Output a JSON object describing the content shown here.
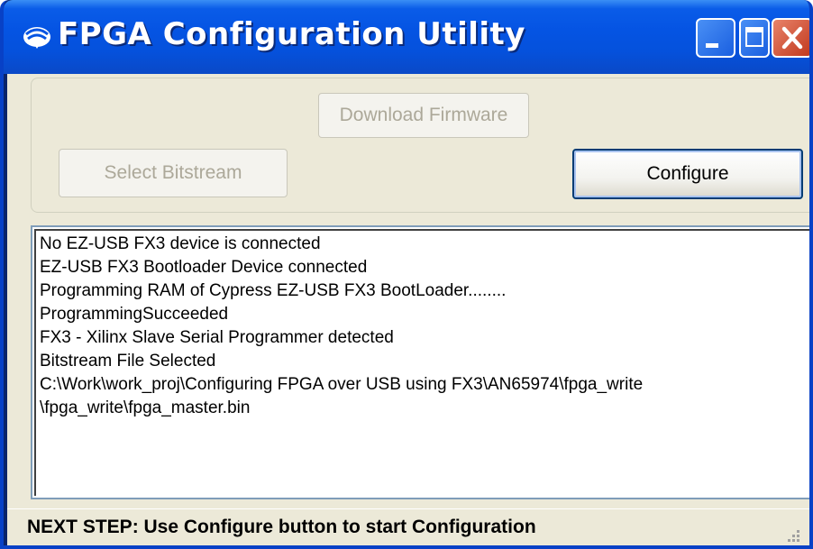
{
  "window": {
    "title": "FPGA Configuration Utility",
    "icon": "cypress-logo-icon",
    "controls": [
      "minimize-icon",
      "maximize-icon",
      "close-icon"
    ]
  },
  "buttons": {
    "download_firmware": {
      "label": "Download Firmware",
      "enabled": false
    },
    "select_bitstream": {
      "label": "Select Bitstream",
      "enabled": false
    },
    "configure": {
      "label": "Configure",
      "enabled": true
    }
  },
  "log": {
    "lines": [
      "No EZ-USB  FX3 device is connected",
      "EZ-USB FX3 Bootloader Device connected",
      "Programming RAM of Cypress EZ-USB FX3 BootLoader........",
      "ProgrammingSucceeded",
      "FX3 - Xilinx Slave Serial Programmer detected",
      "Bitstream File Selected",
      "C:\\Work\\work_proj\\Configuring FPGA over USB using FX3\\AN65974\\fpga_write",
      "\\fpga_write\\fpga_master.bin"
    ]
  },
  "status": {
    "text": "NEXT STEP: Use Configure button to start Configuration"
  },
  "colors": {
    "titlebar": "#0554e3",
    "client": "#ece9d8",
    "disabled_text": "#aca899",
    "close_button": "#c1381d"
  }
}
